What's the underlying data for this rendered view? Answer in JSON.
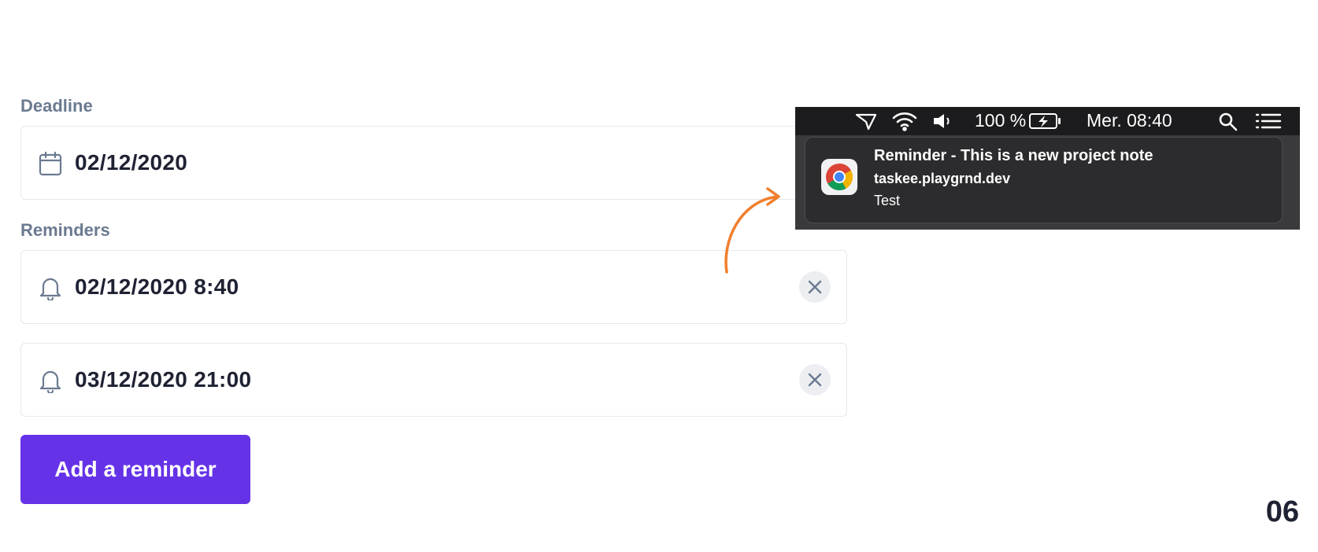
{
  "form": {
    "deadline_label": "Deadline",
    "deadline_value": "02/12/2020",
    "reminders_label": "Reminders",
    "reminders": [
      {
        "value": "02/12/2020 8:40"
      },
      {
        "value": "03/12/2020 21:00"
      }
    ],
    "add_reminder_label": "Add a reminder",
    "accent_color": "#6532e8"
  },
  "menubar": {
    "battery": "100 %",
    "clock": "Mer. 08:40",
    "icons": [
      "location-icon",
      "wifi-icon",
      "volume-icon",
      "battery-charging-icon",
      "spotlight-search-icon",
      "notification-center-icon"
    ]
  },
  "notification": {
    "title": "Reminder - This is a new project note",
    "site": "taskee.playgrnd.dev",
    "body": "Test",
    "app_icon": "chrome-icon"
  },
  "page_number": "06"
}
